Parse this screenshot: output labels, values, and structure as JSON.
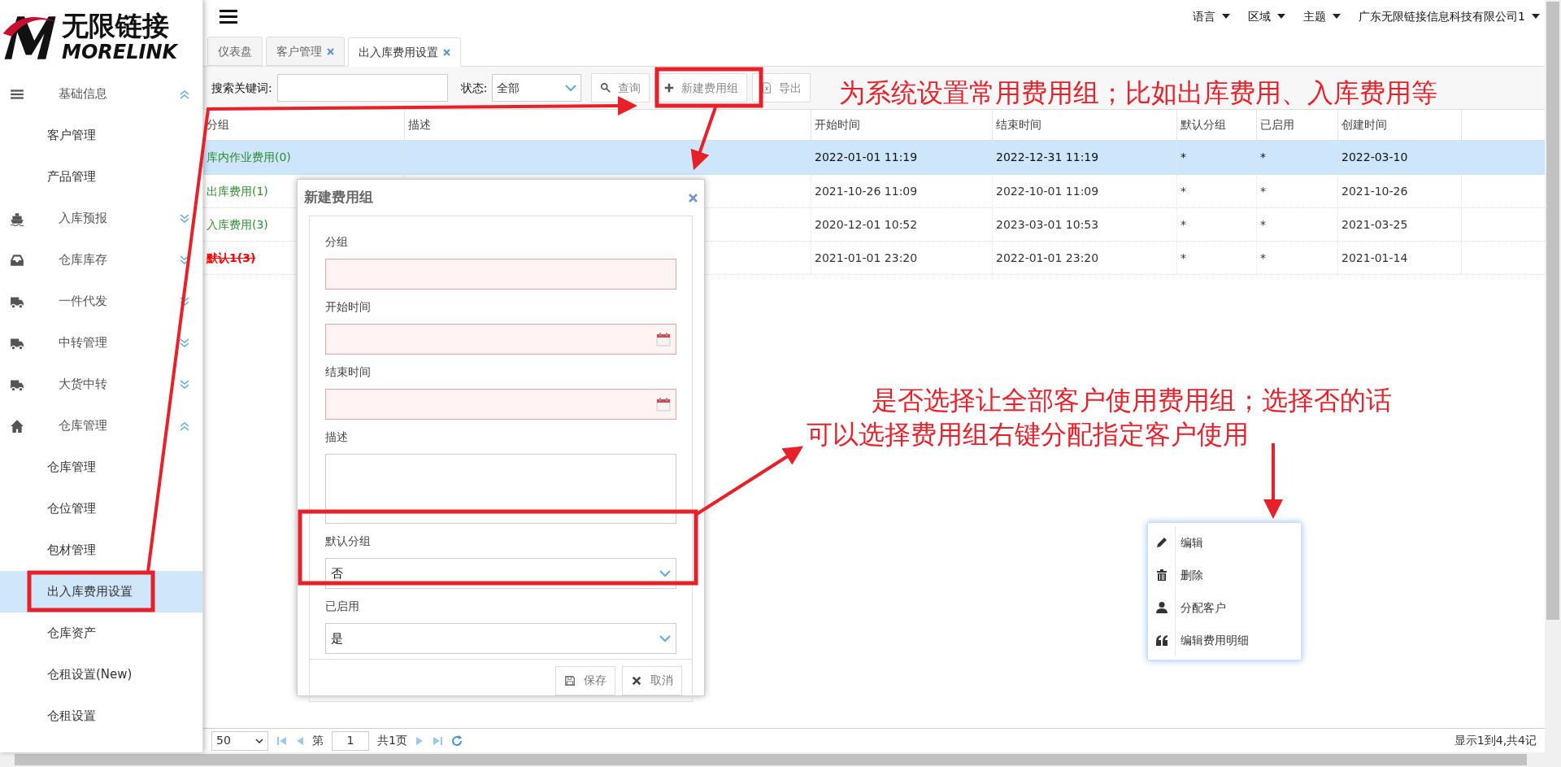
{
  "logo": {
    "name": "无限链接",
    "latin": "MORELINK"
  },
  "sidebar": {
    "groups": [
      {
        "label": "基础信息",
        "kind": "menu",
        "expanded": true,
        "children": [
          {
            "label": "客户管理",
            "selected": false
          },
          {
            "label": "产品管理",
            "selected": false
          }
        ]
      },
      {
        "label": "入库预报",
        "kind": "ship",
        "expanded": false
      },
      {
        "label": "仓库库存",
        "kind": "inbox",
        "expanded": false
      },
      {
        "label": "一件代发",
        "kind": "truck",
        "expanded": false
      },
      {
        "label": "中转管理",
        "kind": "truck",
        "expanded": false
      },
      {
        "label": "大货中转",
        "kind": "truck",
        "expanded": false
      },
      {
        "label": "仓库管理",
        "kind": "home",
        "expanded": true,
        "children": [
          {
            "label": "仓库管理",
            "selected": false
          },
          {
            "label": "仓位管理",
            "selected": false
          },
          {
            "label": "包材管理",
            "selected": false
          },
          {
            "label": "出入库费用设置",
            "selected": true
          },
          {
            "label": "仓库资产",
            "selected": false
          },
          {
            "label": "仓租设置(New)",
            "selected": false
          },
          {
            "label": "仓租设置",
            "selected": false
          }
        ]
      }
    ]
  },
  "top_menu": [
    "语言",
    "区域",
    "主题",
    "广东无限链接信息科技有限公司1"
  ],
  "tabs": [
    {
      "label": "仪表盘",
      "closable": false,
      "selected": false
    },
    {
      "label": "客户管理",
      "closable": true,
      "selected": false
    },
    {
      "label": "出入库费用设置",
      "closable": true,
      "selected": true
    }
  ],
  "toolbar": {
    "search_label": "搜索关键词:",
    "status_label": "状态:",
    "status_value": "全部",
    "buttons": [
      {
        "label": "查询",
        "kind": "search"
      },
      {
        "label": "新建费用组",
        "kind": "plus"
      },
      {
        "label": "导出",
        "kind": "excel"
      }
    ]
  },
  "table": {
    "columns": [
      "分组",
      "描述",
      "开始时间",
      "结束时间",
      "默认分组",
      "已启用",
      "创建时间"
    ],
    "rows": [
      {
        "selected": true,
        "color": "#2e8b2e",
        "struck": false,
        "cells": [
          "库内作业费用(0)",
          "",
          "2022-01-01 11:19",
          "2022-12-31 11:19",
          "*",
          "*",
          "2022-03-10"
        ]
      },
      {
        "selected": false,
        "color": "#2e8b2e",
        "struck": false,
        "cells": [
          "出库费用(1)",
          "",
          "2021-10-26 11:09",
          "2022-10-01 11:09",
          "*",
          "*",
          "2021-10-26"
        ]
      },
      {
        "selected": false,
        "color": "#2e8b2e",
        "struck": false,
        "cells": [
          "入库费用(3)",
          "",
          "2020-12-01 10:52",
          "2023-03-01 10:53",
          "*",
          "*",
          "2021-03-25"
        ]
      },
      {
        "selected": false,
        "color": "#ff0000",
        "struck": true,
        "cells": [
          "默认1(3)",
          "",
          "2021-01-01 23:20",
          "2022-01-01 23:20",
          "*",
          "*",
          "2021-01-14"
        ]
      }
    ]
  },
  "dialog": {
    "title": "新建费用组",
    "fields": [
      {
        "label": "分组",
        "kind": "text",
        "required": true
      },
      {
        "label": "开始时间",
        "kind": "date",
        "required": true
      },
      {
        "label": "结束时间",
        "kind": "date",
        "required": true
      },
      {
        "label": "描述",
        "kind": "textarea",
        "required": false
      },
      {
        "label": "默认分组",
        "kind": "select",
        "required": false,
        "value": "否"
      },
      {
        "label": "已启用",
        "kind": "select",
        "required": false,
        "value": "是"
      }
    ],
    "buttons": [
      {
        "label": "保存",
        "kind": "save"
      },
      {
        "label": "取消",
        "kind": "cancel"
      }
    ]
  },
  "context_menu": [
    {
      "label": "编辑",
      "kind": "edit"
    },
    {
      "label": "删除",
      "kind": "delete"
    },
    {
      "label": "分配客户",
      "kind": "user"
    },
    {
      "label": "编辑费用明细",
      "kind": "quote"
    }
  ],
  "pagination": {
    "page_size": "50",
    "page_prefix": "第",
    "page": "1",
    "page_suffix": "共1页",
    "summary": "显示1到4,共4记"
  },
  "annotations": [
    "为系统设置常用费用组；比如出库费用、入库费用等",
    "是否选择让全部客户使用费用组；选择否的话",
    "可以选择费用组右键分配指定客户使用"
  ]
}
